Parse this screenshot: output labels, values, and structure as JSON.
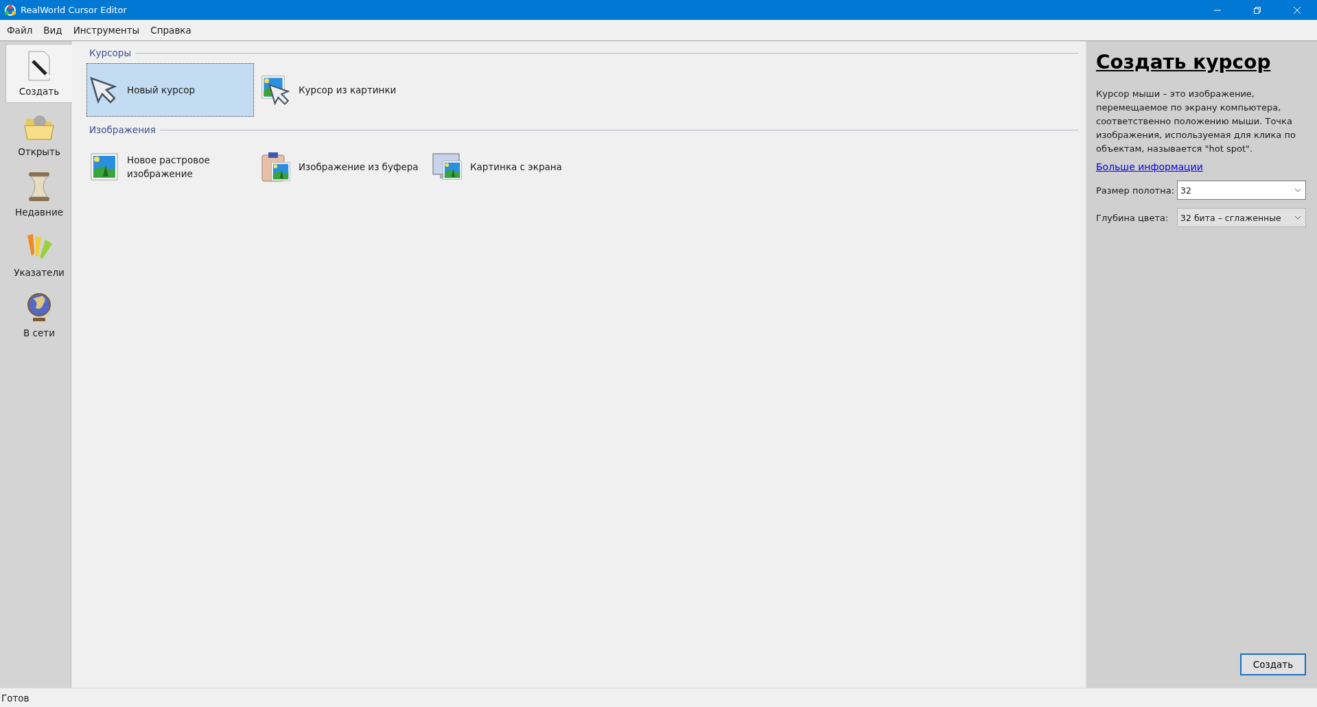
{
  "window": {
    "title": "RealWorld Cursor Editor"
  },
  "menu": [
    "Файл",
    "Вид",
    "Инструменты",
    "Справка"
  ],
  "sidebar": [
    {
      "label": "Создать",
      "kind": "create",
      "selected": true
    },
    {
      "label": "Открыть",
      "kind": "open",
      "selected": false
    },
    {
      "label": "Недавние",
      "kind": "recent",
      "selected": false
    },
    {
      "label": "Указатели",
      "kind": "pointers",
      "selected": false
    },
    {
      "label": "В сети",
      "kind": "online",
      "selected": false
    }
  ],
  "sections": [
    {
      "title": "Курсоры",
      "items": [
        {
          "label": "Новый курсор",
          "kind": "cursor",
          "selected": true
        },
        {
          "label": "Курсор из картинки",
          "kind": "cursor-from-image",
          "selected": false
        }
      ]
    },
    {
      "title": "Изображения",
      "items": [
        {
          "label": "Новое растровое изображение",
          "kind": "image",
          "selected": false
        },
        {
          "label": "Изображение из буфера",
          "kind": "clipboard",
          "selected": false
        },
        {
          "label": "Картинка с экрана",
          "kind": "screen",
          "selected": false
        }
      ]
    }
  ],
  "panel": {
    "title": "Создать курсор",
    "description": "Курсор мыши – это изображение, перемещаемое по экрану компьютера, соответственно положению мыши. Точка изображения, используемая для клика по объектам, называется \"hot spot\".",
    "link": "Больше информации",
    "fields": [
      {
        "label": "Размер полотна:",
        "value": "32",
        "kind": "editable"
      },
      {
        "label": "Глубина цвета:",
        "value": "32 бита – сглаженные",
        "kind": "readonly"
      }
    ],
    "button": "Создать"
  },
  "status_bar": "Готов"
}
